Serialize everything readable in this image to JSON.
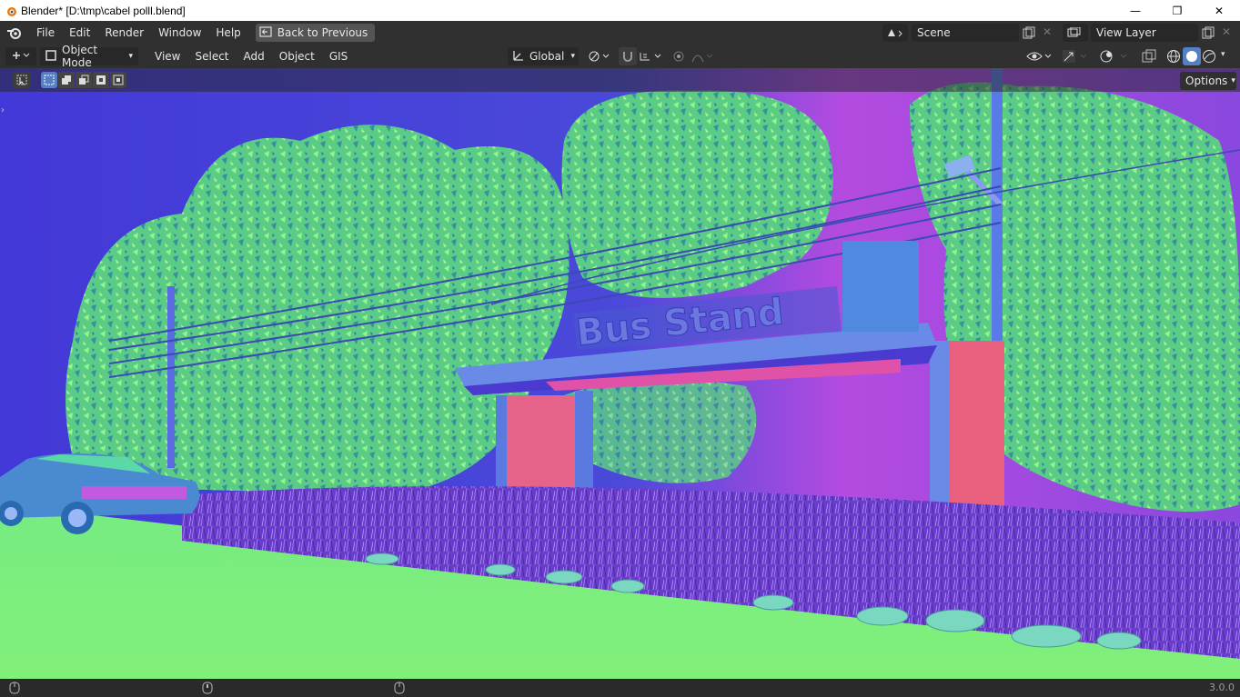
{
  "window": {
    "title": "Blender* [D:\\tmp\\cabel polll.blend]",
    "minimize": "—",
    "maximize": "❐",
    "close": "✕"
  },
  "menu": {
    "items": [
      "File",
      "Edit",
      "Render",
      "Window",
      "Help"
    ],
    "back_button": "Back to Previous",
    "scene": "Scene",
    "view_layer": "View Layer"
  },
  "header3d": {
    "mode": "Object Mode",
    "menus": [
      "View",
      "Select",
      "Add",
      "Object",
      "GIS"
    ],
    "orientation": "Global"
  },
  "toolrow": {
    "options": "Options"
  },
  "viewport": {
    "sign_text": "Bus Stand"
  },
  "status": {
    "version": "3.0.0"
  },
  "colors": {
    "sky_left": "#3a3ad8",
    "sky_right": "#c040d8",
    "ground": "#7ef07a",
    "foliage": "#58d87c",
    "grass": "#7a3ad8",
    "structure": "#5a7ae0",
    "pillar": "#e8607e"
  }
}
